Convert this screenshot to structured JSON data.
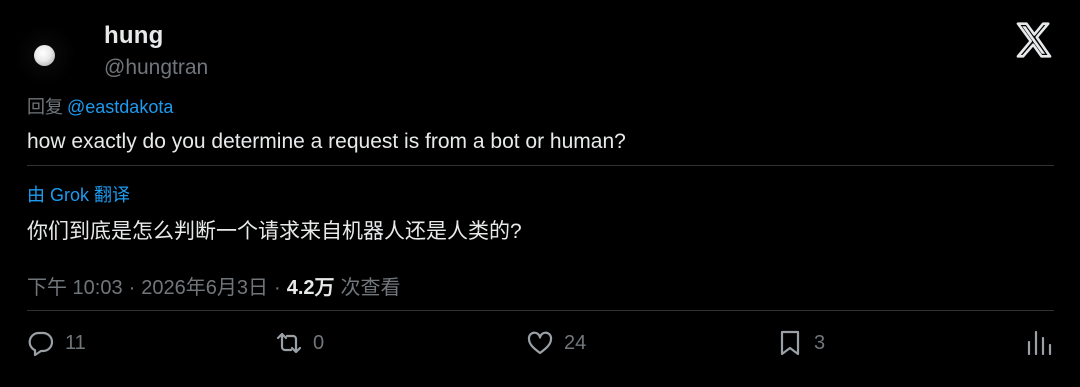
{
  "author": {
    "display_name": "hung",
    "handle": "@hungtran"
  },
  "reply": {
    "prefix": "回复",
    "mention": "@eastdakota"
  },
  "tweet": {
    "text": "how exactly do you determine a request is from a bot or human?"
  },
  "translation": {
    "label": "由 Grok 翻译",
    "text": "你们到底是怎么判断一个请求来自机器人还是人类的?"
  },
  "meta": {
    "time": "下午 10:03",
    "date": "2026年6月3日",
    "views_count": "4.2万",
    "views_label": "次查看",
    "separator": "·"
  },
  "actions": {
    "replies": "11",
    "reposts": "0",
    "likes": "24",
    "bookmarks": "3"
  },
  "colors": {
    "background": "#000000",
    "text": "#e7e9ea",
    "secondary": "#71767b",
    "link": "#1d9bf0"
  },
  "icons": [
    "moon-avatar",
    "x-logo-icon",
    "reply-icon",
    "repost-icon",
    "like-icon",
    "bookmark-icon",
    "analytics-icon"
  ]
}
